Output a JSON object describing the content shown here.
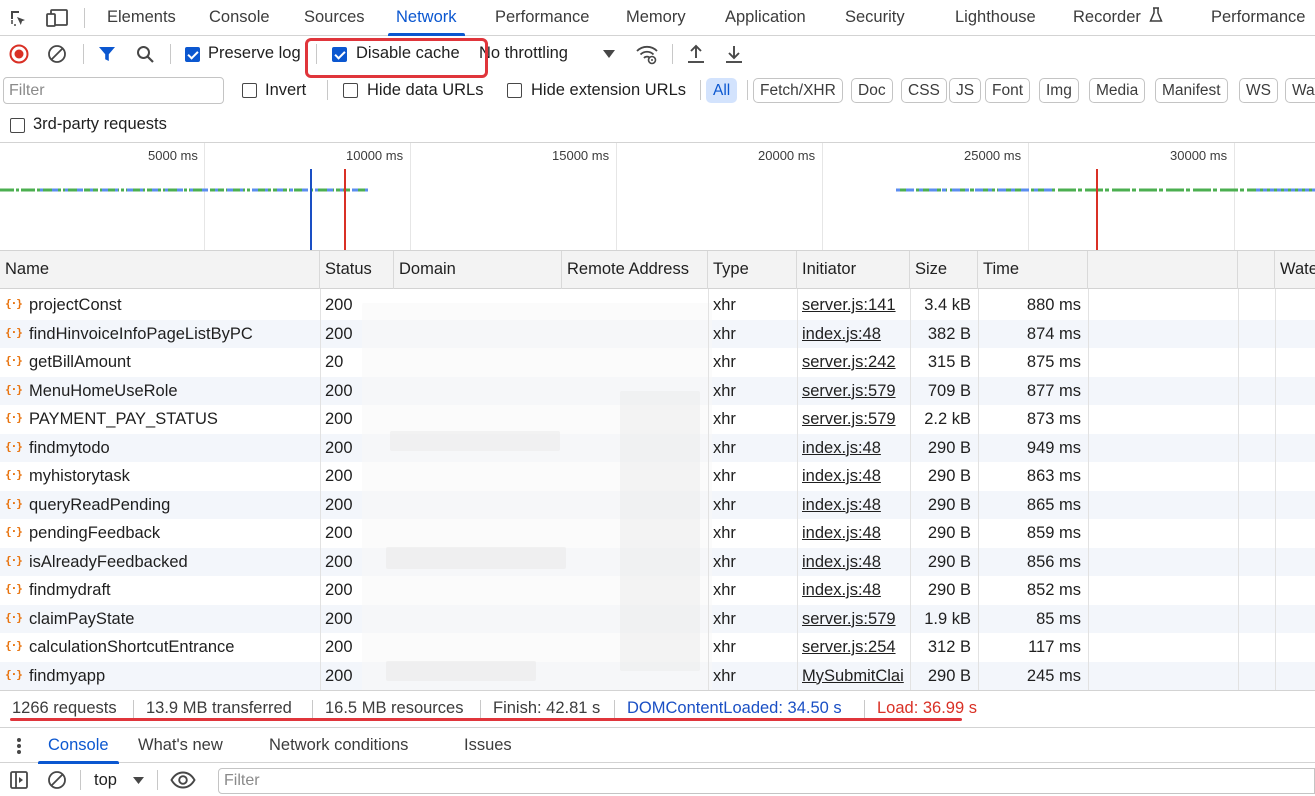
{
  "tabs": {
    "items": [
      {
        "label": "Elements",
        "active": false
      },
      {
        "label": "Console",
        "active": false
      },
      {
        "label": "Sources",
        "active": false
      },
      {
        "label": "Network",
        "active": true
      },
      {
        "label": "Performance",
        "active": false
      },
      {
        "label": "Memory",
        "active": false
      },
      {
        "label": "Application",
        "active": false
      },
      {
        "label": "Security",
        "active": false
      },
      {
        "label": "Lighthouse",
        "active": false
      },
      {
        "label": "Recorder",
        "active": false
      },
      {
        "label": "Performance",
        "active": false
      }
    ]
  },
  "toolbar": {
    "preserve_log": {
      "label": "Preserve log",
      "checked": true
    },
    "disable_cache": {
      "label": "Disable cache",
      "checked": true
    },
    "throttling": "No throttling"
  },
  "filters": {
    "placeholder": "Filter",
    "invert": {
      "label": "Invert",
      "checked": false
    },
    "hide_data_urls": {
      "label": "Hide data URLs",
      "checked": false
    },
    "hide_extension_urls": {
      "label": "Hide extension URLs",
      "checked": false
    },
    "type_pills": [
      "All",
      "Fetch/XHR",
      "Doc",
      "CSS",
      "JS",
      "Font",
      "Img",
      "Media",
      "Manifest",
      "WS",
      "Wasm"
    ],
    "active_pill": "All",
    "third_party": {
      "label": "3rd-party requests",
      "checked": false
    }
  },
  "overview": {
    "ticks": [
      "5000 ms",
      "10000 ms",
      "15000 ms",
      "20000 ms",
      "25000 ms",
      "30000 ms"
    ]
  },
  "table": {
    "columns": [
      "Name",
      "Status",
      "Domain",
      "Remote Address",
      "Type",
      "Initiator",
      "Size",
      "Time",
      "",
      "Waterfall"
    ],
    "rows": [
      {
        "name": "projectConst",
        "status": "200",
        "type": "xhr",
        "initiator": "server.js:141",
        "size": "3.4 kB",
        "time": "880 ms"
      },
      {
        "name": "findHinvoiceInfoPageListByPC",
        "status": "200",
        "type": "xhr",
        "initiator": "index.js:48",
        "size": "382 B",
        "time": "874 ms"
      },
      {
        "name": "getBillAmount",
        "status": "20",
        "type": "xhr",
        "initiator": "server.js:242",
        "size": "315 B",
        "time": "875 ms"
      },
      {
        "name": "MenuHomeUseRole",
        "status": "200",
        "type": "xhr",
        "initiator": "server.js:579",
        "size": "709 B",
        "time": "877 ms"
      },
      {
        "name": "PAYMENT_PAY_STATUS",
        "status": "200",
        "type": "xhr",
        "initiator": "server.js:579",
        "size": "2.2 kB",
        "time": "873 ms"
      },
      {
        "name": "findmytodo",
        "status": "200",
        "type": "xhr",
        "initiator": "index.js:48",
        "size": "290 B",
        "time": "949 ms"
      },
      {
        "name": "myhistorytask",
        "status": "200",
        "type": "xhr",
        "initiator": "index.js:48",
        "size": "290 B",
        "time": "863 ms"
      },
      {
        "name": "queryReadPending",
        "status": "200",
        "type": "xhr",
        "initiator": "index.js:48",
        "size": "290 B",
        "time": "865 ms"
      },
      {
        "name": "pendingFeedback",
        "status": "200",
        "type": "xhr",
        "initiator": "index.js:48",
        "size": "290 B",
        "time": "859 ms"
      },
      {
        "name": "isAlreadyFeedbacked",
        "status": "200",
        "type": "xhr",
        "initiator": "index.js:48",
        "size": "290 B",
        "time": "856 ms"
      },
      {
        "name": "findmydraft",
        "status": "200",
        "type": "xhr",
        "initiator": "index.js:48",
        "size": "290 B",
        "time": "852 ms"
      },
      {
        "name": "claimPayState",
        "status": "200",
        "type": "xhr",
        "initiator": "server.js:579",
        "size": "1.9 kB",
        "time": "85 ms"
      },
      {
        "name": "calculationShortcutEntrance",
        "status": "200",
        "type": "xhr",
        "initiator": "server.js:254",
        "size": "312 B",
        "time": "117 ms"
      },
      {
        "name": "findmyapp",
        "status": "200",
        "type": "xhr",
        "initiator": "MySubmitClai",
        "size": "290 B",
        "time": "245 ms"
      }
    ]
  },
  "summary": {
    "requests": "1266 requests",
    "transferred": "13.9 MB transferred",
    "resources": "16.5 MB resources",
    "finish": "Finish: 42.81 s",
    "dom_content_loaded": "DOMContentLoaded: 34.50 s",
    "load": "Load: 36.99 s"
  },
  "drawer": {
    "tabs": [
      "Console",
      "What's new",
      "Network conditions",
      "Issues"
    ],
    "active_tab": "Console",
    "context": "top",
    "filter_placeholder": "Filter"
  },
  "colors": {
    "accent": "#0b57d0",
    "dom_content_loaded": "#1a4fc4",
    "load": "#d93025",
    "annotation": "#e0353b",
    "xhr_icon": "#e8710a"
  },
  "icons": [
    "inspect-element-icon",
    "device-toggle-icon",
    "record-stop-icon",
    "clear-icon",
    "filter-funnel-icon",
    "search-icon",
    "dropdown-arrow-icon",
    "network-conditions-icon",
    "import-har-icon",
    "export-har-icon",
    "kebab-menu-icon",
    "sidebar-toggle-icon",
    "eye-icon",
    "recorder-flask-icon"
  ]
}
